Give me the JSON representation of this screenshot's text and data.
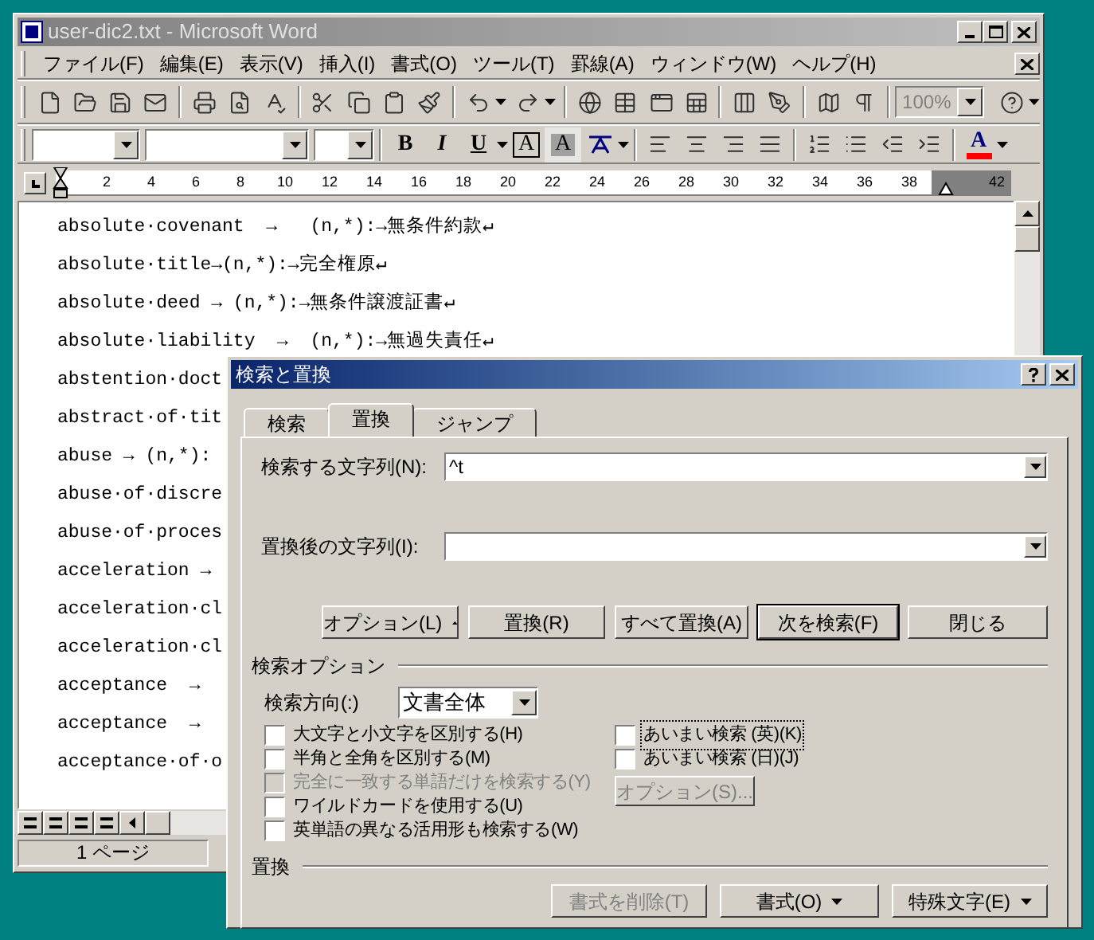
{
  "window": {
    "title": "user-dic2.txt - Microsoft Word"
  },
  "menu": [
    "ファイル(F)",
    "編集(E)",
    "表示(V)",
    "挿入(I)",
    "書式(O)",
    "ツール(T)",
    "罫線(A)",
    "ウィンドウ(W)",
    "ヘルプ(H)"
  ],
  "toolbar": {
    "zoom": "100%"
  },
  "format_buttons": [
    {
      "label": "B",
      "kind": "bold"
    },
    {
      "label": "I",
      "kind": "italic"
    },
    {
      "label": "U",
      "kind": "underline"
    },
    {
      "label": "A",
      "kind": "boxed"
    },
    {
      "label": "A",
      "kind": "shaded"
    }
  ],
  "font_color": {
    "label": "A",
    "color": "#ff0000"
  },
  "ruler": {
    "ticks": [
      "2",
      "4",
      "6",
      "8",
      "10",
      "12",
      "14",
      "16",
      "18",
      "20",
      "22",
      "24",
      "26",
      "28",
      "30",
      "32",
      "34",
      "36",
      "38",
      "42"
    ]
  },
  "document": {
    "lines": [
      "absolute·covenant  →   (n,*):→無条件約款↵",
      "absolute·title→(n,*):→完全権原↵",
      "absolute·deed → (n,*):→無条件譲渡証書↵",
      "absolute·liability  →  (n,*):→無過失責任↵",
      "abstention·doct",
      "abstract·of·tit",
      "abuse → (n,*):",
      "abuse·of·discre",
      "abuse·of·proces",
      "acceleration →",
      "acceleration·cl",
      "acceleration·cl",
      "acceptance  →",
      "acceptance  →",
      "acceptance·of·o"
    ]
  },
  "status_bar": {
    "page": "1 ページ"
  },
  "dialog": {
    "title": "検索と置換",
    "tabs": [
      {
        "label": "検索",
        "selected": false
      },
      {
        "label": "置換",
        "selected": true
      },
      {
        "label": "ジャンプ",
        "selected": false
      }
    ],
    "find": {
      "label": "検索する文字列(N):",
      "value": "^t"
    },
    "replace": {
      "label": "置換後の文字列(I):"
    },
    "buttons": [
      {
        "label": "オプション(L)",
        "kind": "toggle",
        "default": false
      },
      {
        "label": "置換(R)",
        "kind": "plain",
        "default": false
      },
      {
        "label": "すべて置換(A)",
        "kind": "plain",
        "default": false
      },
      {
        "label": "次を検索(F)",
        "kind": "plain",
        "default": true
      },
      {
        "label": "閉じる",
        "kind": "plain",
        "default": false
      }
    ],
    "options_heading": "検索オプション",
    "direction": {
      "label": "検索方向(:)",
      "value": "文書全体"
    },
    "checkboxes": [
      {
        "label": "大文字と小文字を区別する(H)",
        "checked": false,
        "disabled": false,
        "focused": false
      },
      {
        "label": "半角と全角を区別する(M)",
        "checked": false,
        "disabled": false,
        "focused": false
      },
      {
        "label": "完全に一致する単語だけを検索する(Y)",
        "checked": false,
        "disabled": true,
        "focused": false
      },
      {
        "label": "ワイルドカードを使用する(U)",
        "checked": false,
        "disabled": false,
        "focused": false
      },
      {
        "label": "英単語の異なる活用形も検索する(W)",
        "checked": false,
        "disabled": false,
        "focused": false
      }
    ],
    "fuzzy_checkboxes": [
      {
        "label": "あいまい検索 (英)(K)",
        "checked": false,
        "disabled": false,
        "focused": true
      },
      {
        "label": "あいまい検索 (日)(J)",
        "checked": false,
        "disabled": false,
        "focused": false
      }
    ],
    "fuzzy_options": {
      "label": "オプション(S)...",
      "disabled": true
    },
    "replace_heading": "置換",
    "bottom_buttons": [
      {
        "label": "書式を削除(T)",
        "disabled": true,
        "dropdown": false
      },
      {
        "label": "書式(O)",
        "disabled": false,
        "dropdown": true
      },
      {
        "label": "特殊文字(E)",
        "disabled": false,
        "dropdown": true
      }
    ]
  }
}
